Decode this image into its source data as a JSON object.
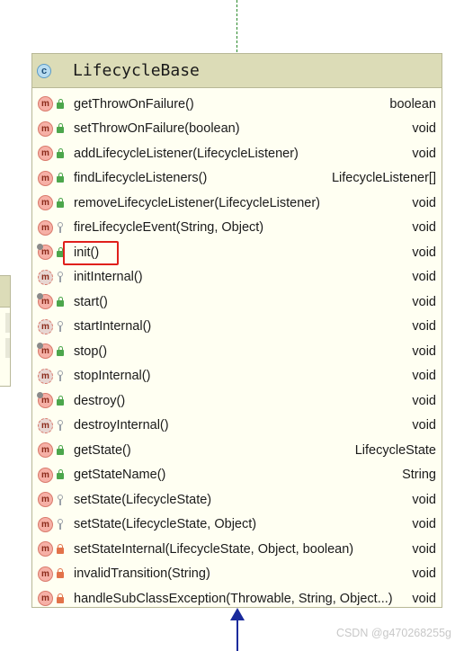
{
  "class": {
    "icon": "class-icon",
    "icon_letter": "c",
    "name": "LifecycleBase"
  },
  "methods": [
    {
      "name": "getThrowOnFailure()",
      "type": "boolean",
      "visibility": "public",
      "abstract": false,
      "overrides": false
    },
    {
      "name": "setThrowOnFailure(boolean)",
      "type": "void",
      "visibility": "public",
      "abstract": false,
      "overrides": false
    },
    {
      "name": "addLifecycleListener(LifecycleListener)",
      "type": "void",
      "visibility": "public",
      "abstract": false,
      "overrides": false
    },
    {
      "name": "findLifecycleListeners()",
      "type": "LifecycleListener[]",
      "visibility": "public",
      "abstract": false,
      "overrides": false
    },
    {
      "name": "removeLifecycleListener(LifecycleListener)",
      "type": "void",
      "visibility": "public",
      "abstract": false,
      "overrides": false
    },
    {
      "name": "fireLifecycleEvent(String, Object)",
      "type": "void",
      "visibility": "protected",
      "abstract": false,
      "overrides": false
    },
    {
      "name": "init()",
      "type": "void",
      "visibility": "public",
      "abstract": false,
      "overrides": true,
      "highlighted": true
    },
    {
      "name": "initInternal()",
      "type": "void",
      "visibility": "protected",
      "abstract": true,
      "overrides": false
    },
    {
      "name": "start()",
      "type": "void",
      "visibility": "public",
      "abstract": false,
      "overrides": true
    },
    {
      "name": "startInternal()",
      "type": "void",
      "visibility": "protected",
      "abstract": true,
      "overrides": false
    },
    {
      "name": "stop()",
      "type": "void",
      "visibility": "public",
      "abstract": false,
      "overrides": true
    },
    {
      "name": "stopInternal()",
      "type": "void",
      "visibility": "protected",
      "abstract": true,
      "overrides": false
    },
    {
      "name": "destroy()",
      "type": "void",
      "visibility": "public",
      "abstract": false,
      "overrides": true
    },
    {
      "name": "destroyInternal()",
      "type": "void",
      "visibility": "protected",
      "abstract": true,
      "overrides": false
    },
    {
      "name": "getState()",
      "type": "LifecycleState",
      "visibility": "public",
      "abstract": false,
      "overrides": false
    },
    {
      "name": "getStateName()",
      "type": "String",
      "visibility": "public",
      "abstract": false,
      "overrides": false
    },
    {
      "name": "setState(LifecycleState)",
      "type": "void",
      "visibility": "protected",
      "abstract": false,
      "overrides": false
    },
    {
      "name": "setState(LifecycleState, Object)",
      "type": "void",
      "visibility": "protected",
      "abstract": false,
      "overrides": false
    },
    {
      "name": "setStateInternal(LifecycleState, Object, boolean)",
      "type": "void",
      "visibility": "private",
      "abstract": false,
      "overrides": false
    },
    {
      "name": "invalidTransition(String)",
      "type": "void",
      "visibility": "private",
      "abstract": false,
      "overrides": false
    },
    {
      "name": "handleSubClassException(Throwable, String, Object...)",
      "type": "void",
      "visibility": "private",
      "abstract": false,
      "overrides": false
    }
  ],
  "method_icon_letter": "m",
  "colors": {
    "header_bg": "#dcdcb7",
    "body_bg": "#fffff2",
    "highlight": "#e0201c",
    "arrow": "#1a2a9c",
    "dashed_line": "#2e8b2e"
  },
  "watermark": "CSDN @g470268255g"
}
